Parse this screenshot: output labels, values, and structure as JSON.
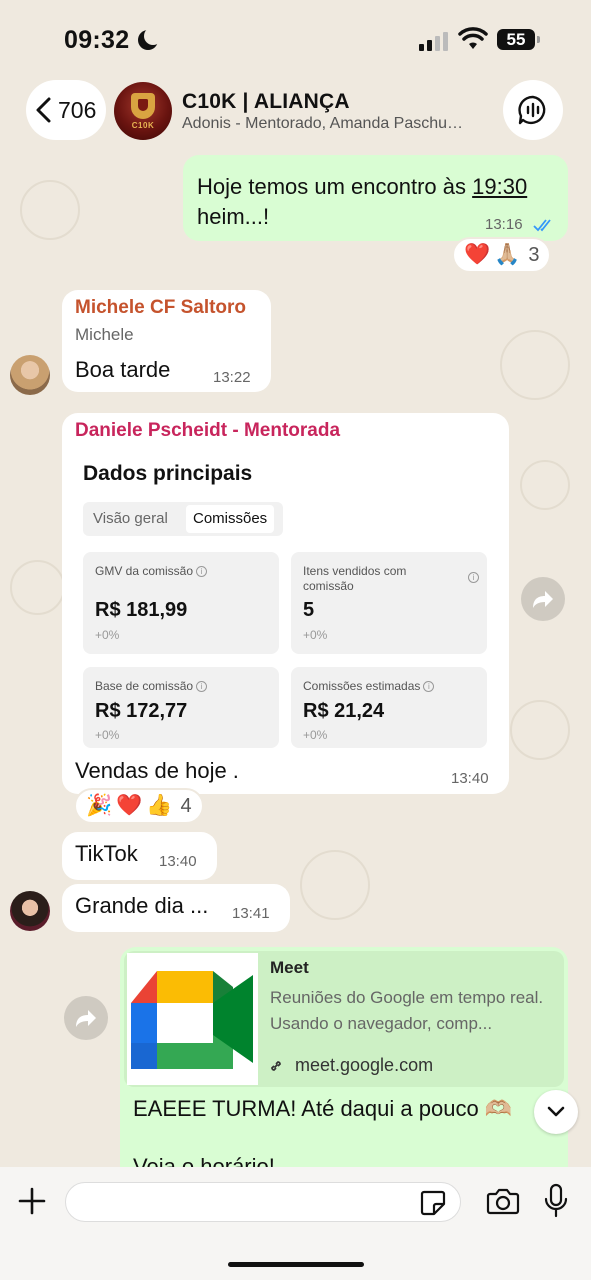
{
  "status_bar": {
    "time": "09:32",
    "battery": "55"
  },
  "header": {
    "back_count": "706",
    "group_name": "C10K | ALIANÇA",
    "members": "Adonis - Mentorado, Amanda Paschu…",
    "avatar_text": "C10K"
  },
  "messages": {
    "m1": {
      "text_before": "Hoje temos um encontro às ",
      "time_link": "19:30",
      "text_after": "heim...!",
      "time": "13:16",
      "reactions": [
        "❤️",
        "🙏🏼"
      ],
      "reaction_count": "3"
    },
    "m2": {
      "sender": "Michele CF Saltoro",
      "subname": "Michele",
      "text": "Boa tarde",
      "time": "13:22"
    },
    "m3": {
      "sender": "Daniele Pscheidt - Mentorada",
      "card": {
        "title": "Dados principais",
        "tabs": [
          "Visão geral",
          "Comissões"
        ],
        "stats": [
          {
            "label": "GMV da comissão",
            "value": "R$ 181,99",
            "delta": "+0%"
          },
          {
            "label": "Itens vendidos com comissão",
            "value": "5",
            "delta": "+0%"
          },
          {
            "label": "Base de comissão",
            "value": "R$ 172,77",
            "delta": "+0%"
          },
          {
            "label": "Comissões estimadas",
            "value": "R$ 21,24",
            "delta": "+0%"
          }
        ]
      },
      "caption": "Vendas de hoje .",
      "time": "13:40",
      "reactions": [
        "🎉",
        "❤️",
        "👍"
      ],
      "reaction_count": "4"
    },
    "m4": {
      "text": "TikTok",
      "time": "13:40"
    },
    "m5": {
      "text": "Grande dia ...",
      "time": "13:41"
    },
    "m6": {
      "link_title": "Meet",
      "link_desc": "Reuniões do Google em tempo real. Usando o navegador, comp...",
      "link_url": "meet.google.com",
      "text": "EAEEE TURMA! Até daqui a pouco 🫶🏼",
      "text2": "Veja o horário!"
    }
  },
  "icons": [
    "back-chevron-icon",
    "voice-chat-icon",
    "forward-icon",
    "link-icon",
    "plus-icon",
    "sticker-icon",
    "camera-icon",
    "microphone-icon",
    "chevron-down-icon",
    "read-receipt-icon"
  ]
}
